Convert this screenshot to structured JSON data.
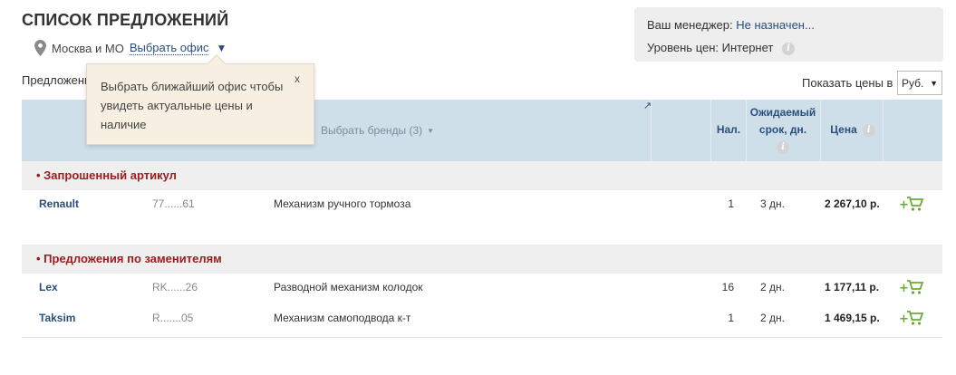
{
  "page": {
    "title": "СПИСОК ПРЕДЛОЖЕНИЙ"
  },
  "location": {
    "city": "Москва и МО",
    "office_link": "Выбрать офис",
    "arrow": "▼"
  },
  "manager": {
    "label": "Ваш менеджер:",
    "value": "Не назначен...",
    "price_level_label": "Уровень цен:",
    "price_level_value": "Интернет"
  },
  "offers_label": "Предложения",
  "show_prices": {
    "label": "Показать цены в",
    "currency": "Руб."
  },
  "table": {
    "brands_filter": "Выбрать бренды (3)",
    "col_qty": "Нал.",
    "col_expected": [
      "Ожидаемый",
      "срок, дн."
    ],
    "col_price": "Цена"
  },
  "tooltip": {
    "text": "Выбрать ближайший офис чтобы увидеть актуальные цены и наличие",
    "close": "x"
  },
  "groups": [
    {
      "title": "• Запрошенный артикул",
      "rows": [
        {
          "brand": "Renault",
          "article": "77......61",
          "description": "Механизм ручного тормоза",
          "qty": "1",
          "term": "3 дн.",
          "price": "2 267,10 р."
        }
      ]
    },
    {
      "title": "• Предложения по заменителям",
      "rows": [
        {
          "brand": "Lex",
          "article": "RK......26",
          "description": "Разводной механизм колодок",
          "qty": "16",
          "term": "2 дн.",
          "price": "1 177,11 р."
        },
        {
          "brand": "Taksim",
          "article": "R.......05",
          "description": "Механизм самоподвода к-т",
          "qty": "1",
          "term": "2 дн.",
          "price": "1 469,15 р."
        }
      ]
    }
  ],
  "colors": {
    "link": "#2a4f7e",
    "group_title": "#9b1c1c",
    "header_bg": "#cfdfea",
    "cart": "#6aaa3a"
  }
}
